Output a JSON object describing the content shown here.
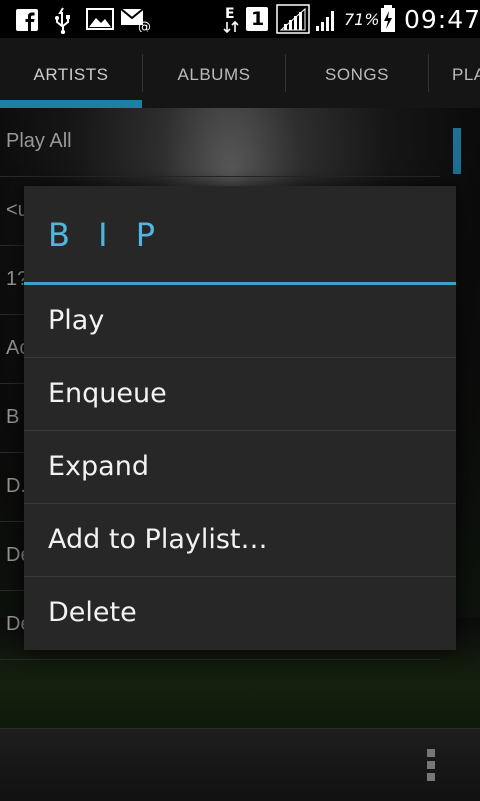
{
  "status_bar": {
    "icons": [
      "facebook-icon",
      "usb-icon",
      "gallery-icon",
      "email-icon",
      "data-transfer-icon",
      "sim-1-icon",
      "signal-icon",
      "signal-2-icon",
      "battery-charging-icon"
    ],
    "sim_label": "1",
    "battery_percent": "71%",
    "time": "09:47"
  },
  "tabs": [
    {
      "label": "ARTISTS",
      "selected": true
    },
    {
      "label": "ALBUMS"
    },
    {
      "label": "SONGS"
    },
    {
      "label": "PLA"
    }
  ],
  "list": {
    "rows": [
      "Play All",
      "<u",
      "1?",
      "Ac",
      "B",
      "D.",
      "De",
      "De"
    ]
  },
  "dialog": {
    "title": "B I P",
    "items": [
      "Play",
      "Enqueue",
      "Expand",
      "Add to Playlist…",
      "Delete"
    ]
  },
  "colors": {
    "accent": "#3aa0cc",
    "title": "#4fb6e0",
    "dialog_bg": "#272727"
  }
}
